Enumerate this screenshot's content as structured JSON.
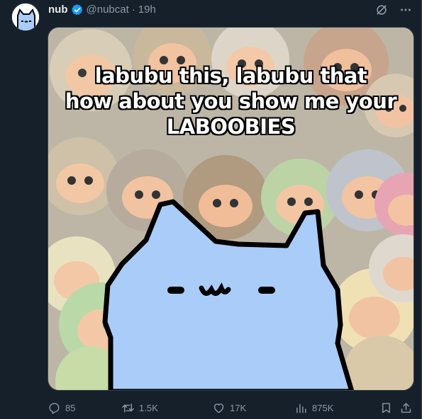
{
  "author": {
    "display_name": "nub",
    "handle": "@nubcat",
    "separator": "·",
    "time": "19h",
    "verified": true
  },
  "media": {
    "caption_lines": [
      "labubu this, labubu that",
      "how about you show me your",
      "LABOOBIES"
    ]
  },
  "actions": {
    "replies": "85",
    "reposts": "1.5K",
    "likes": "17K",
    "views": "875K"
  },
  "colors": {
    "background": "#15202b",
    "secondary_text": "#8b98a5",
    "verified_badge": "#1d9bf0",
    "cat_fill": "#a9cdf8"
  }
}
